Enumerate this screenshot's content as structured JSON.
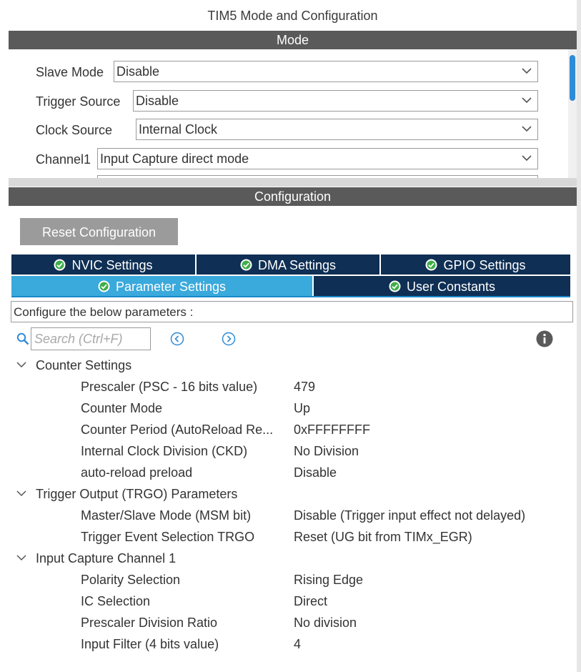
{
  "window_title": "TIM5 Mode and Configuration",
  "mode_section": {
    "header": "Mode",
    "fields": [
      {
        "label": "Slave Mode",
        "value": "Disable"
      },
      {
        "label": "Trigger Source",
        "value": "Disable"
      },
      {
        "label": "Clock Source",
        "value": "Internal Clock"
      },
      {
        "label": "Channel1",
        "value": "Input Capture direct mode"
      }
    ]
  },
  "config_section": {
    "header": "Configuration",
    "reset_button": "Reset Configuration",
    "tabs_row1": [
      {
        "label": "NVIC Settings",
        "icon": "check-circle-icon"
      },
      {
        "label": "DMA Settings",
        "icon": "check-circle-icon"
      },
      {
        "label": "GPIO Settings",
        "icon": "check-circle-icon"
      }
    ],
    "tabs_row2": [
      {
        "label": "Parameter Settings",
        "icon": "check-circle-icon",
        "active": true
      },
      {
        "label": "User Constants",
        "icon": "check-circle-icon",
        "active": false
      }
    ],
    "configure_text": "Configure the below parameters :",
    "search_placeholder": "Search (Ctrl+F)"
  },
  "parameter_groups": [
    {
      "name": "Counter Settings",
      "params": [
        {
          "name": "Prescaler (PSC - 16 bits value)",
          "value": "479"
        },
        {
          "name": "Counter Mode",
          "value": "Up"
        },
        {
          "name": "Counter Period (AutoReload Re...",
          "value": "0xFFFFFFFF"
        },
        {
          "name": "Internal Clock Division (CKD)",
          "value": "No Division"
        },
        {
          "name": "auto-reload preload",
          "value": "Disable"
        }
      ]
    },
    {
      "name": "Trigger Output (TRGO) Parameters",
      "params": [
        {
          "name": "Master/Slave Mode (MSM bit)",
          "value": "Disable (Trigger input effect not delayed)"
        },
        {
          "name": "Trigger Event Selection TRGO",
          "value": "Reset (UG bit from TIMx_EGR)"
        }
      ]
    },
    {
      "name": "Input Capture Channel 1",
      "params": [
        {
          "name": "Polarity Selection",
          "value": "Rising Edge"
        },
        {
          "name": "IC Selection",
          "value": "Direct"
        },
        {
          "name": "Prescaler Division Ratio",
          "value": "No division"
        },
        {
          "name": "Input Filter (4 bits value)",
          "value": "4"
        }
      ]
    }
  ],
  "colors": {
    "section_header": "#5a5a5a",
    "tab_dark": "#0f2f54",
    "tab_active": "#3aa9dc",
    "check_green": "#3fae49",
    "scrollbar": "#2e8bd6"
  }
}
